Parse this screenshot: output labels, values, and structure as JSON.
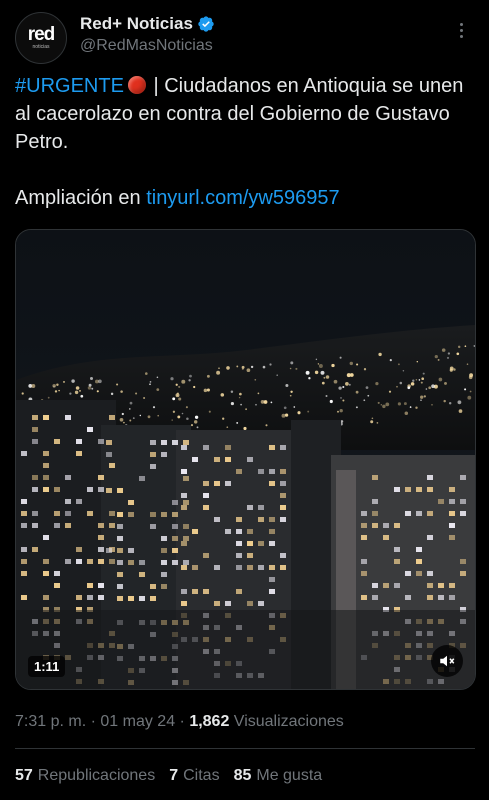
{
  "author": {
    "display_name": "Red+ Noticias",
    "handle": "@RedMasNoticias",
    "avatar_logo": "red",
    "avatar_logo_sub": "noticias",
    "verified_color": "#1d9bf0"
  },
  "tweet": {
    "hashtag": "#URGENTE",
    "text_after_emoji": " | Ciudadanos en Antioquia se unen al cacerolazo en contra del Gobierno de Gustavo Petro.",
    "ampliacion_label": "Ampliación en ",
    "link": "tinyurl.com/yw596957"
  },
  "media": {
    "duration": "1:11",
    "mute_icon": "speaker-muted-icon"
  },
  "meta": {
    "time": "7:31 p. m.",
    "separator1": " · ",
    "date": "01 may 24",
    "separator2": " · ",
    "views_count": "1,862",
    "views_label": " Visualizaciones"
  },
  "stats": {
    "reposts_count": "57",
    "reposts_label": "Republicaciones",
    "quotes_count": "7",
    "quotes_label": "Citas",
    "likes_count": "85",
    "likes_label": "Me gusta"
  },
  "colors": {
    "background": "#000000",
    "text": "#e7e9ea",
    "secondary": "#71767b",
    "accent": "#1d9bf0",
    "divider": "#2f3336"
  }
}
